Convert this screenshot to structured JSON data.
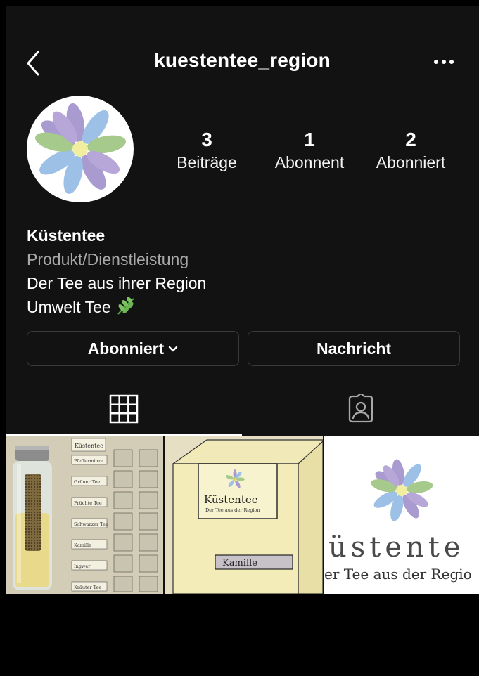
{
  "header": {
    "username": "kuestentee_region",
    "back_icon": "chevron-left-icon",
    "more_icon": "more-horizontal-icon"
  },
  "stats": {
    "posts_count": "3",
    "posts_label": "Beiträge",
    "followers_count": "1",
    "followers_label": "Abonnent",
    "following_count": "2",
    "following_label": "Abonniert"
  },
  "bio": {
    "name": "Küstentee",
    "category": "Produkt/Dienstleistung",
    "line1": "Der Tee aus ihrer Region",
    "line2": "Umwelt Tee"
  },
  "actions": {
    "follow_label": "Abonniert",
    "message_label": "Nachricht"
  },
  "tabs": [
    "grid-icon",
    "tagged-icon"
  ],
  "posts": [
    {
      "labels": {
        "brand": "Küstentee",
        "rows": [
          "Pfefferminze",
          "Grüner Tee",
          "Früchte Tee",
          "Schwarzer Tee",
          "Kamille",
          "Ingwer",
          "Kräuter Tee"
        ]
      }
    },
    {
      "labels": {
        "brand": "Küstentee",
        "tagline": "Der Tee aus der Region",
        "flavor": "Kamille"
      }
    },
    {
      "labels": {
        "brand_partial": "üstente",
        "tagline_partial": "er Tee aus der Regio"
      }
    }
  ],
  "colors": {
    "background": "#121212",
    "secondary_text": "#a8a8a8",
    "flower_purple": "#a99bd0",
    "flower_blue": "#9cc0e6",
    "flower_green": "#a6c98c",
    "flower_center": "#f2eea0"
  }
}
